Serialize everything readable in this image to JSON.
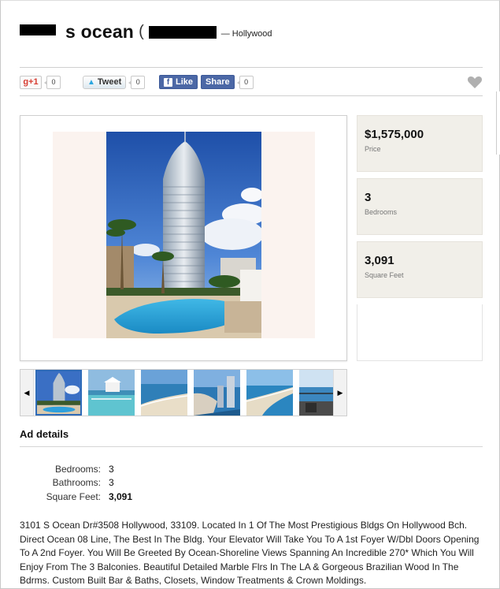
{
  "listing": {
    "title_text": "s ocean",
    "title_paren": "(",
    "city_text": "— Hollywood"
  },
  "social": {
    "gplus_label": "g+1",
    "gplus_count": "0",
    "tweet_label": "Tweet",
    "tweet_count": "0",
    "fb_like_label": "Like",
    "fb_share_label": "Share",
    "fb_share_count": "0"
  },
  "stats": [
    {
      "value": "$1,575,000",
      "label": "Price"
    },
    {
      "value": "3",
      "label": "Bedrooms"
    },
    {
      "value": "3,091",
      "label": "Square Feet"
    }
  ],
  "details": {
    "section_title": "Ad details",
    "rows": [
      {
        "key": "Bedrooms:",
        "value": "3"
      },
      {
        "key": "Bathrooms:",
        "value": "3"
      },
      {
        "key": "Square Feet:",
        "value": "3,091"
      }
    ],
    "description": "3101 S Ocean Dr#3508 Hollywood, 33109. Located In 1 Of The Most Prestigious Bldgs On Hollywood Bch. Direct Ocean 08 Line, The Best In The Bldg. Your Elevator Will Take You To A 1st Foyer W/Dbl Doors Opening To A 2nd Foyer. You Will Be Greeted By Ocean-Shoreline Views Spanning An Incredible 270* Which You Will Enjoy From The 3 Balconies. Beautiful Detailed Marble Flrs In The LA & Gorgeous Brazilian Wood In The Bdrms. Custom Built Bar & Baths, Closets, Window Treatments & Crown Moldings."
  },
  "colors": {
    "selected_thumb_border": "#2e6bb8",
    "stat_background": "#f1efe9",
    "facebook_blue": "#4c68a6",
    "gplus_red": "#d73d32"
  },
  "icons": {
    "favorite": "heart-icon",
    "prev": "chevron-left-icon",
    "next": "chevron-right-icon",
    "twitter": "twitter-bird-icon",
    "facebook": "facebook-f-icon"
  }
}
